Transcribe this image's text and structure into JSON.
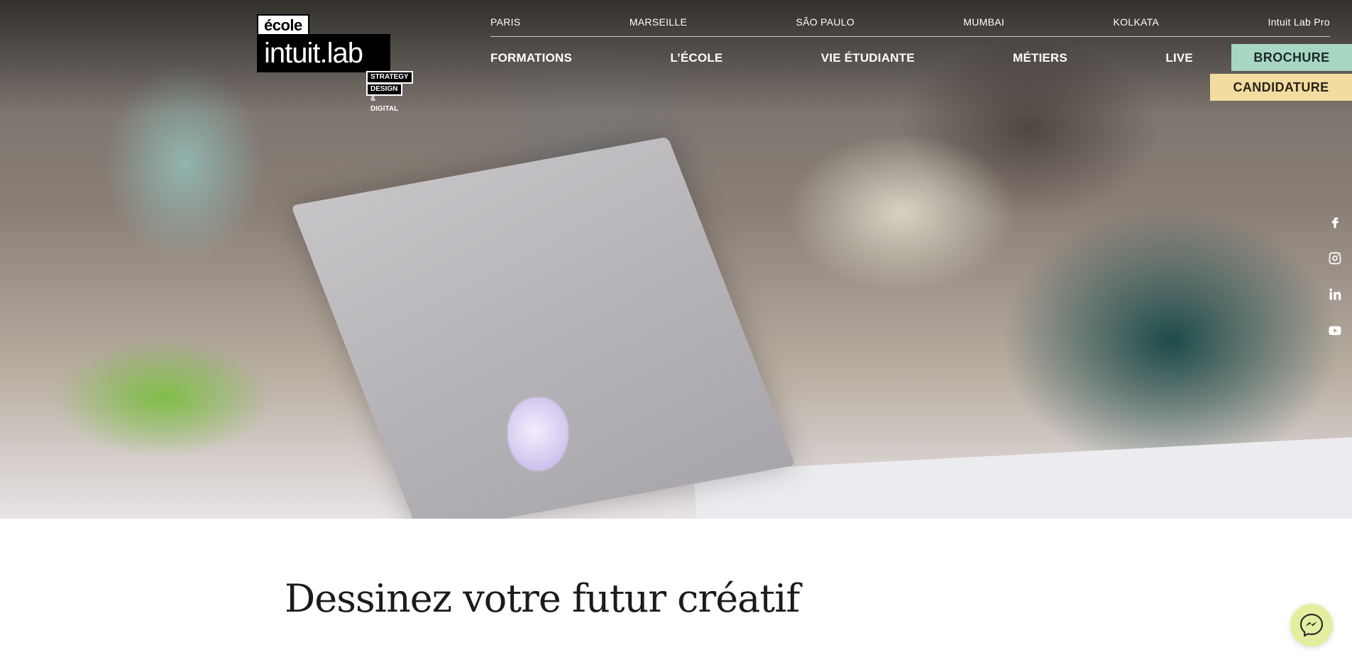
{
  "logo": {
    "line1": "école",
    "line2": "intuit.lab",
    "tag1": "STRATEGY",
    "tag2": "DESIGN & DIGITAL"
  },
  "city_nav": {
    "items": [
      "PARIS",
      "MARSEILLE",
      "SÃO PAULO",
      "MUMBAI",
      "KOLKATA",
      "Intuit Lab Pro"
    ]
  },
  "main_nav": {
    "items": [
      "FORMATIONS",
      "L’ÉCOLE",
      "VIE ÉTUDIANTE",
      "MÉTIERS",
      "LIVE"
    ]
  },
  "cta": {
    "brochure": "BROCHURE",
    "candidature": "CANDIDATURE"
  },
  "social": [
    "facebook-icon",
    "instagram-icon",
    "linkedin-icon",
    "youtube-icon"
  ],
  "main": {
    "headline": "Dessinez votre futur créatif"
  },
  "colors": {
    "brochure_bg": "#a7d6c2",
    "candidature_bg": "#f3dc9f",
    "messenger_bg": "#e5ee9e"
  }
}
